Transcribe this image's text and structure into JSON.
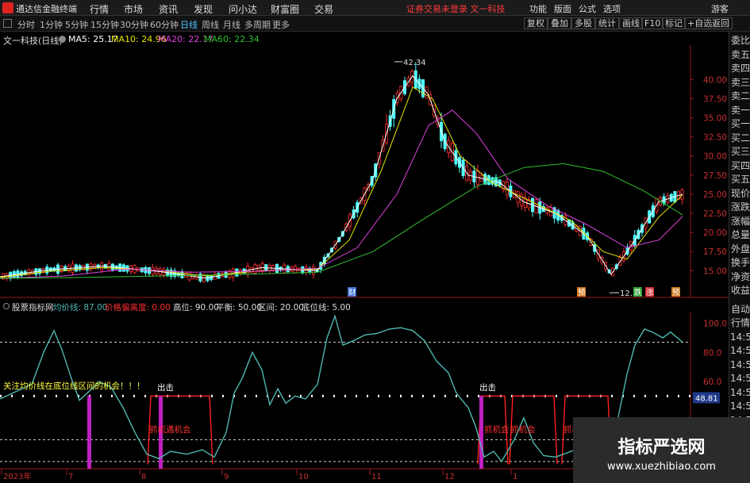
{
  "menubar": {
    "app_title": "通达信金融终端",
    "items": [
      "行情",
      "市场",
      "资讯",
      "发现",
      "问小达",
      "财富圈",
      "交易"
    ],
    "notice": "证券交易未登录  文一科技",
    "right_items": [
      "功能",
      "版面",
      "公式",
      "选项"
    ],
    "guest": "游客"
  },
  "toolbar": {
    "periods": [
      "分时",
      "1分钟",
      "5分钟",
      "15分钟",
      "30分钟",
      "60分钟",
      "日线",
      "周线",
      "月线",
      "多周期",
      "更多"
    ],
    "active": "日线",
    "right_buttons": [
      "复权",
      "叠加",
      "多股",
      "统计",
      "画线",
      "F10",
      "标记",
      "+自选",
      "返回"
    ]
  },
  "main_header": {
    "stock": "文一科技(日线)",
    "ma5": "MA5: 25.17",
    "ma10": "MA10: 24.96",
    "ma20": "MA20: 22.17",
    "ma60": "MA60: 22.34"
  },
  "annotations": {
    "high": "42.34",
    "low": "12.11",
    "marks": [
      "财",
      "预",
      "跌",
      "涨",
      "预"
    ]
  },
  "side_panel": [
    "委比",
    "卖五",
    "卖四",
    "卖三",
    "卖二",
    "卖一",
    "买一",
    "买二",
    "买三",
    "买四",
    "买五",
    "现价",
    "涨跌",
    "涨幅",
    "总量",
    "外盘",
    "换手",
    "净资",
    "收益",
    "自动",
    "行情",
    "14:5",
    "14:5",
    "14:5",
    "14:5",
    "14:5",
    "14:5",
    "14:5",
    "14:5"
  ],
  "indicator_header": {
    "name": "股票指标网",
    "avg": "均价线: 87.00",
    "deviation": "价格偏离度: 0.00",
    "high": "高位: 90.00",
    "balance": "平衡: 50.00",
    "range": "区间: 20.00",
    "bottom": "底位线: 5.00"
  },
  "indicator_labels": {
    "notice": "关注均价线在底位线区间的机会！！！",
    "out1": "出击",
    "out2": "出击",
    "chance1": "抓机遇机会",
    "chance2": "抓机会",
    "chance3": "抓机会",
    "chance4": "抓机遇机会",
    "current_value": "48.81"
  },
  "date_axis": [
    "2023年",
    "7",
    "8",
    "9",
    "10",
    "11",
    "12",
    "1"
  ],
  "watermark": {
    "title": "指标严选网",
    "url": "www.xuezhibiao.com"
  },
  "colors": {
    "up": "#ff3030",
    "down": "#54ffff",
    "ma5": "#ffffff",
    "ma10": "#e6e600",
    "ma20": "#e040e0",
    "ma60": "#30c030",
    "indicator_line": "#4fb8b0",
    "chance_line": "#ff2020",
    "signal_bar": "#c020c0"
  },
  "chart_data": [
    {
      "type": "candlestick",
      "title": "文一科技(日线)",
      "y_ticks": [
        15.0,
        17.5,
        20.0,
        22.5,
        25.0,
        27.5,
        30.0,
        32.5,
        35.0,
        37.5,
        40.0
      ],
      "ylim": [
        11.5,
        44.5
      ],
      "series": [
        {
          "name": "MA5",
          "points": [
            [
              0,
              14.2
            ],
            [
              60,
              15.1
            ],
            [
              130,
              15.6
            ],
            [
              200,
              14.9
            ],
            [
              260,
              14.0
            ],
            [
              330,
              15.4
            ],
            [
              400,
              15.0
            ],
            [
              430,
              19.5
            ],
            [
              470,
              27.0
            ],
            [
              500,
              37.5
            ],
            [
              520,
              40.5
            ],
            [
              540,
              38.0
            ],
            [
              560,
              32.0
            ],
            [
              590,
              27.5
            ],
            [
              630,
              26.5
            ],
            [
              660,
              24.0
            ],
            [
              700,
              22.5
            ],
            [
              740,
              19.5
            ],
            [
              770,
              14.5
            ],
            [
              800,
              19.0
            ],
            [
              830,
              24.0
            ],
            [
              860,
              25.0
            ]
          ]
        },
        {
          "name": "MA10",
          "points": [
            [
              0,
              14.1
            ],
            [
              60,
              14.9
            ],
            [
              130,
              15.4
            ],
            [
              200,
              15.0
            ],
            [
              260,
              14.3
            ],
            [
              330,
              15.0
            ],
            [
              400,
              15.2
            ],
            [
              440,
              19.0
            ],
            [
              480,
              28.0
            ],
            [
              520,
              39.0
            ],
            [
              545,
              37.5
            ],
            [
              580,
              30.0
            ],
            [
              620,
              26.5
            ],
            [
              670,
              24.0
            ],
            [
              720,
              21.5
            ],
            [
              760,
              17.5
            ],
            [
              790,
              16.5
            ],
            [
              830,
              22.0
            ],
            [
              860,
              24.9
            ]
          ]
        },
        {
          "name": "MA20",
          "points": [
            [
              0,
              14.0
            ],
            [
              80,
              14.3
            ],
            [
              160,
              15.2
            ],
            [
              240,
              14.8
            ],
            [
              320,
              14.9
            ],
            [
              400,
              15.3
            ],
            [
              450,
              18.0
            ],
            [
              500,
              25.0
            ],
            [
              540,
              34.0
            ],
            [
              570,
              36.0
            ],
            [
              600,
              33.0
            ],
            [
              640,
              27.0
            ],
            [
              690,
              23.5
            ],
            [
              740,
              21.0
            ],
            [
              790,
              18.0
            ],
            [
              830,
              19.0
            ],
            [
              860,
              22.1
            ]
          ]
        },
        {
          "name": "MA60",
          "points": [
            [
              0,
              14.0
            ],
            [
              100,
              14.1
            ],
            [
              200,
              14.3
            ],
            [
              300,
              14.5
            ],
            [
              400,
              14.8
            ],
            [
              470,
              17.5
            ],
            [
              530,
              21.5
            ],
            [
              600,
              26.0
            ],
            [
              660,
              28.5
            ],
            [
              710,
              29.0
            ],
            [
              760,
              28.0
            ],
            [
              810,
              25.5
            ],
            [
              860,
              22.3
            ]
          ]
        }
      ]
    },
    {
      "type": "line",
      "title": "股票指标网",
      "y_ticks": [
        60.0,
        80.0,
        100.0
      ],
      "ylim": [
        0,
        108
      ],
      "reference_lines": [
        87.0,
        50.0,
        20.0,
        5.0
      ],
      "series": [
        {
          "name": "均价线",
          "points": [
            [
              0,
              48
            ],
            [
              20,
              53
            ],
            [
              40,
              58
            ],
            [
              55,
              80
            ],
            [
              68,
              95
            ],
            [
              78,
              82
            ],
            [
              90,
              62
            ],
            [
              100,
              47
            ],
            [
              110,
              52
            ],
            [
              125,
              60
            ],
            [
              140,
              56
            ],
            [
              155,
              42
            ],
            [
              170,
              25
            ],
            [
              185,
              10
            ],
            [
              200,
              7
            ],
            [
              215,
              12
            ],
            [
              235,
              10
            ],
            [
              255,
              13
            ],
            [
              270,
              8
            ],
            [
              285,
              25
            ],
            [
              295,
              52
            ],
            [
              305,
              62
            ],
            [
              318,
              80
            ],
            [
              330,
              68
            ],
            [
              340,
              44
            ],
            [
              350,
              55
            ],
            [
              360,
              45
            ],
            [
              372,
              50
            ],
            [
              385,
              48
            ],
            [
              400,
              58
            ],
            [
              412,
              90
            ],
            [
              422,
              105
            ],
            [
              432,
              85
            ],
            [
              445,
              88
            ],
            [
              460,
              92
            ],
            [
              475,
              93
            ],
            [
              490,
              96
            ],
            [
              505,
              97
            ],
            [
              520,
              95
            ],
            [
              535,
              88
            ],
            [
              550,
              74
            ],
            [
              565,
              66
            ],
            [
              575,
              52
            ],
            [
              590,
              42
            ],
            [
              600,
              28
            ],
            [
              610,
              8
            ],
            [
              622,
              12
            ],
            [
              632,
              5
            ],
            [
              648,
              20
            ],
            [
              660,
              35
            ],
            [
              672,
              18
            ],
            [
              685,
              9
            ],
            [
              700,
              8
            ],
            [
              715,
              11
            ],
            [
              730,
              14
            ],
            [
              745,
              18
            ],
            [
              760,
              15
            ],
            [
              775,
              25
            ],
            [
              790,
              65
            ],
            [
              800,
              85
            ],
            [
              812,
              96
            ],
            [
              822,
              94
            ],
            [
              835,
              90
            ],
            [
              845,
              94
            ],
            [
              860,
              87
            ]
          ]
        }
      ]
    }
  ]
}
